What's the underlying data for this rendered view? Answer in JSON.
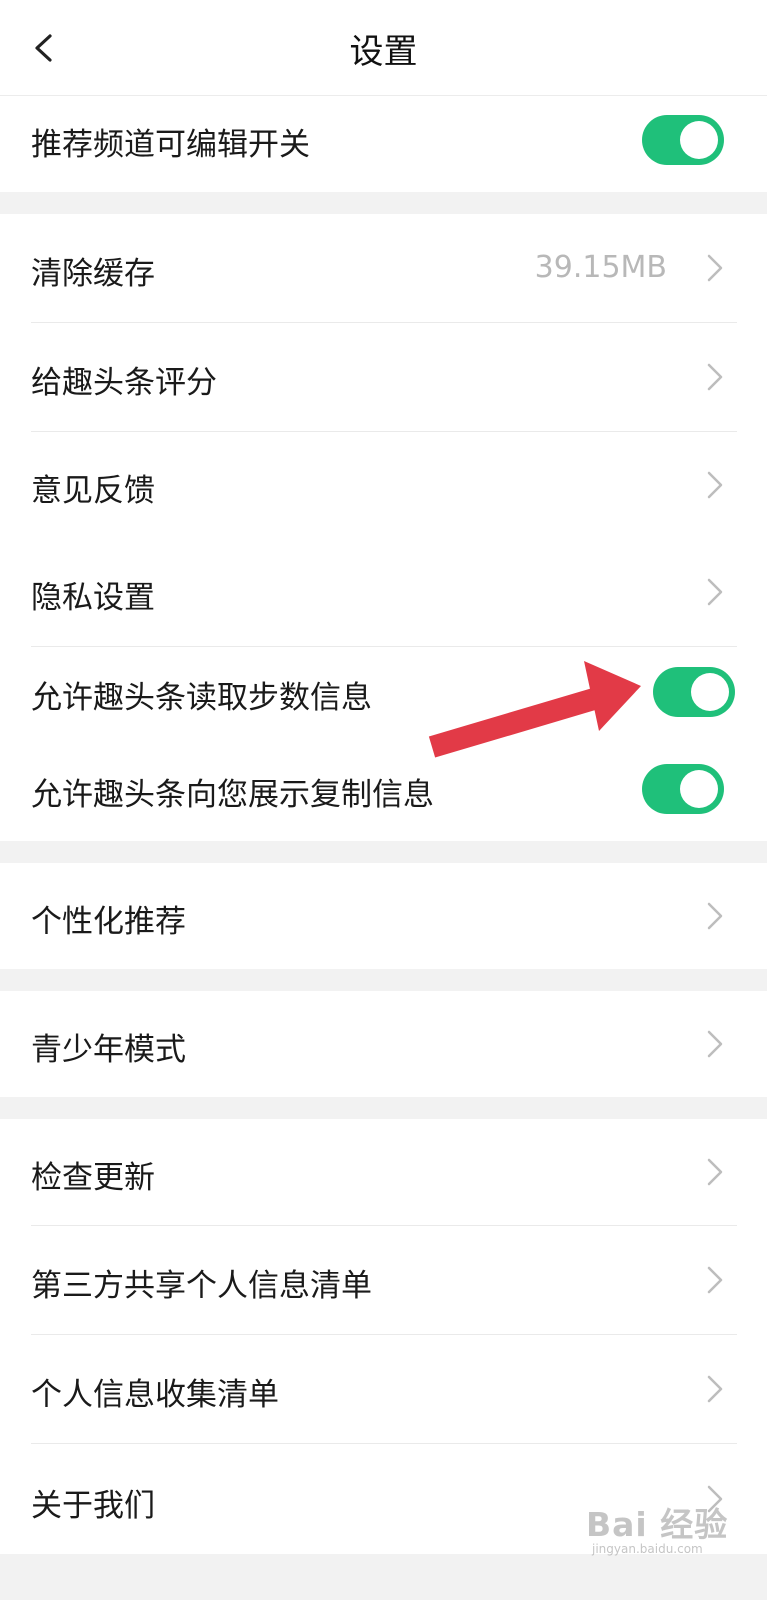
{
  "header": {
    "title": "设置",
    "back_icon": "chevron-left-icon"
  },
  "colors": {
    "accent": "#1fc07a",
    "background": "#f2f2f2",
    "arrow": "#e23a47"
  },
  "sections": {
    "s1": [
      {
        "label": "推荐频道可编辑开关",
        "toggle": true
      }
    ],
    "s2": [
      {
        "label": "清除缓存",
        "value": "39.15MB"
      },
      {
        "label": "给趣头条评分"
      },
      {
        "label": "意见反馈"
      },
      {
        "label": "隐私设置"
      },
      {
        "label": "允许趣头条读取步数信息",
        "toggle": true
      },
      {
        "label": "允许趣头条向您展示复制信息",
        "toggle": true
      }
    ],
    "s3": [
      {
        "label": "个性化推荐"
      }
    ],
    "s4": [
      {
        "label": "青少年模式"
      }
    ],
    "s5": [
      {
        "label": "检查更新"
      },
      {
        "label": "第三方共享个人信息清单"
      },
      {
        "label": "个人信息收集清单"
      },
      {
        "label": "关于我们"
      }
    ]
  },
  "watermark": {
    "main": "Bai 经验",
    "sub": "jingyan.baidu.com"
  }
}
